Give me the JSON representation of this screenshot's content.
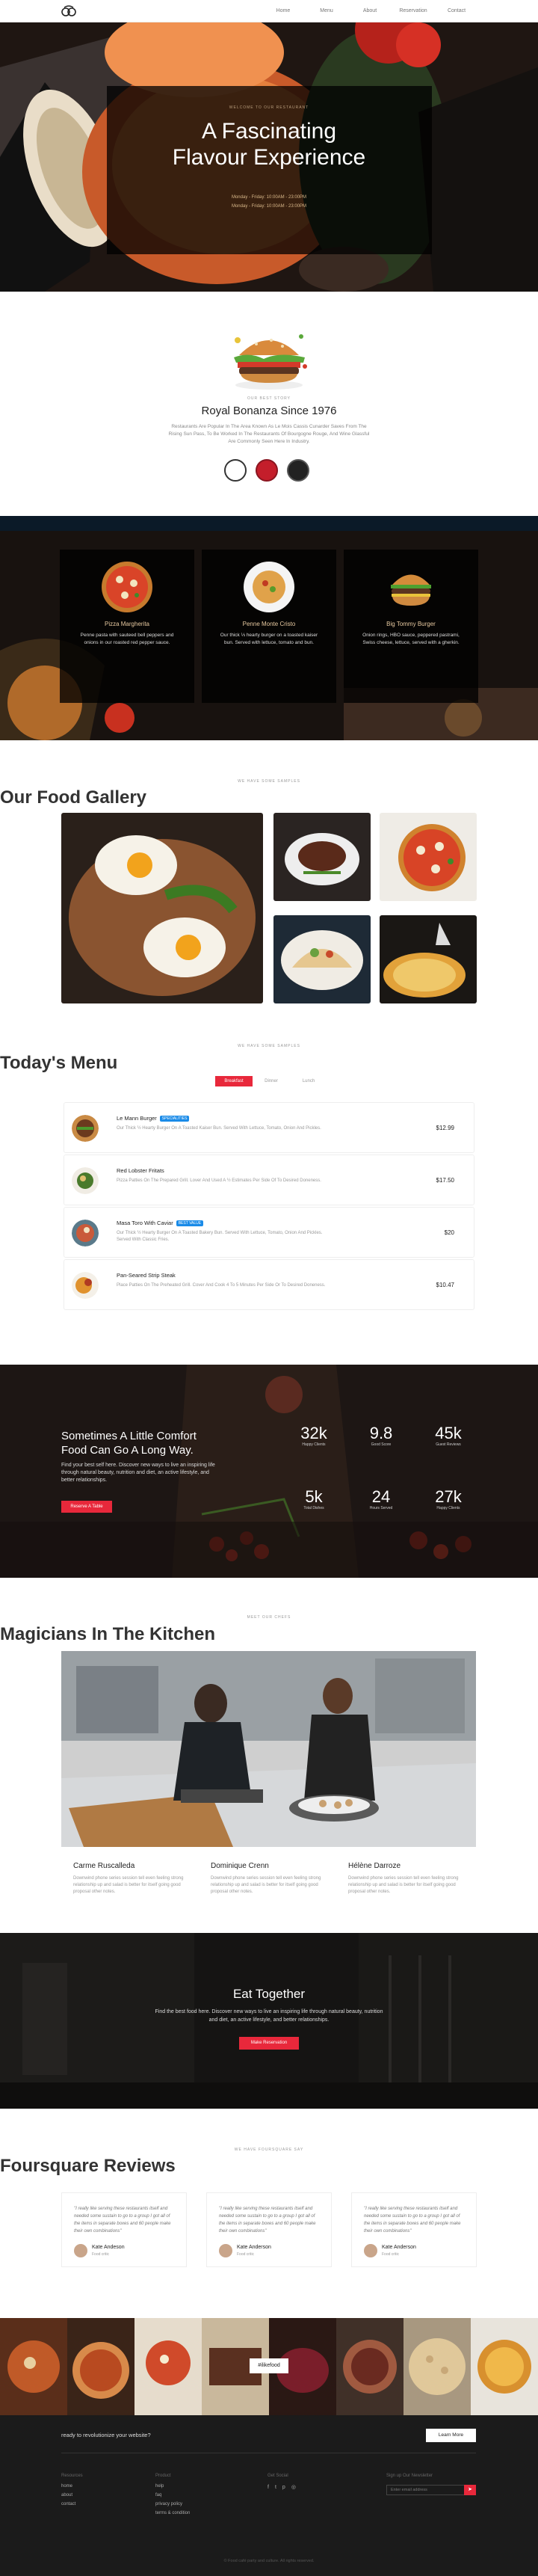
{
  "nav": {
    "items": [
      "Home",
      "Menu",
      "About",
      "Reservation",
      "Contact"
    ]
  },
  "hero": {
    "eyebrow": "WELCOME TO OUR RESTAURANT",
    "title_1": "A Fascinating",
    "title_2": "Flavour Experience",
    "hours_1": "Monday - Friday: 10:00AM - 23:00PM",
    "hours_2": "Monday - Friday: 10:00AM - 23:00PM"
  },
  "about": {
    "eyebrow": "OUR BEST STORY",
    "title": "Royal Bonanza Since 1976",
    "text": "Restaurants Are Popular In The Area Known As Le Mois Cassis Cunarder Saves From The Rising Sun Pass, To Be Worked In The Restaurants Of Bourgogne Rouge, And Wine Glassful Are Commonly Seen Here In Industry."
  },
  "specials": [
    {
      "name": "Pizza Margherita",
      "desc": "Penne pasta with sauteed bell peppers and onions in our roasted red pepper sauce."
    },
    {
      "name": "Penne Monte Cristo",
      "desc": "Our thick ⅓ hearty burger on a toasted kaiser bun. Served with lettuce, tomato and bun."
    },
    {
      "name": "Big Tommy Burger",
      "desc": "Onion rings, HBO sauce, peppered pastrami, Swiss cheese, lettuce, served with a gherkin."
    }
  ],
  "gallery": {
    "eyebrow": "WE HAVE SOME SAMPLES",
    "title": "Our Food Gallery"
  },
  "menu": {
    "eyebrow": "WE HAVE SOME SAMPLES",
    "title": "Today's Menu",
    "tabs": [
      "Breakfast",
      "Dinner",
      "Lunch"
    ],
    "items": [
      {
        "name": "Le Mann Burger",
        "tag": "SPECIALITIES",
        "desc": "Our Thick ½ Hearty Burger On A Toasted Kaiser Bun. Served With Lettuce, Tomato, Onion And Pickles.",
        "price": "$12.99"
      },
      {
        "name": "Red Lobster Fritats",
        "tag": "",
        "desc": "Pizza Patties On The Prepared Grill. Lover And Used A ½ Estimates Per Side Of To Desired Doneness.",
        "price": "$17.50"
      },
      {
        "name": "Masa Toro With Caviar",
        "tag": "BEST VALUE",
        "desc": "Our Thick ½ Hearty Burger On A Toasted Bakery Bun. Served With Lettuce, Tomato, Onion And Pickles. Served With Classic Fries.",
        "price": "$20"
      },
      {
        "name": "Pan-Seared Strip Steak",
        "tag": "",
        "desc": "Place Patties On The Preheated Grill. Cover And Cook 4 To 5 Minutes Per Side Or To Desired Doneness.",
        "price": "$10.47"
      }
    ]
  },
  "stats": {
    "title": "Sometimes A Little Comfort Food Can Go A Long Way.",
    "text": "Find your best self here. Discover new ways to live an inspiring life through natural beauty, nutrition and diet, an active lifestyle, and better relationships.",
    "button": "Reserve A Table",
    "items": [
      {
        "n": "32k",
        "l": "Happy Clients"
      },
      {
        "n": "9.8",
        "l": "Good Score"
      },
      {
        "n": "45k",
        "l": "Guest Reviews"
      },
      {
        "n": "5k",
        "l": "Total Dishes"
      },
      {
        "n": "24",
        "l": "Hours Served"
      },
      {
        "n": "27k",
        "l": "Happy Clients"
      }
    ]
  },
  "team": {
    "eyebrow": "MEET OUR CHEFS",
    "title": "Magicians In The Kitchen",
    "members": [
      {
        "name": "Carme Ruscalleda",
        "desc": "Downwind phone series session tell even feeling strong relationship up and salad is better for itself going good proposal other notes."
      },
      {
        "name": "Dominique Crenn",
        "desc": "Downwind phone series session tell even feeling strong relationship up and salad is better for itself going good proposal other notes."
      },
      {
        "name": "Hélène Darroze",
        "desc": "Downwind phone series session tell even feeling strong relationship up and salad is better for itself going good proposal other notes."
      }
    ]
  },
  "eat": {
    "title": "Eat Together",
    "text": "Find the best food here. Discover new ways to live an inspiring life through natural beauty, nutrition and diet, an active lifestyle, and better relationships.",
    "button": "Make Reservation"
  },
  "reviews": {
    "eyebrow": "WE HAVE FOURSQUARE SAY",
    "title": "Foursquare Reviews",
    "items": [
      {
        "quote": "\"I really like serving these restaurants itself and needed some sustain to go to a group I got all of the items in separate boxes and 60 people make their own combinations\"",
        "name": "Kate Andeson",
        "role": "Food critic"
      },
      {
        "quote": "\"I really like serving these restaurants itself and needed some sustain to go to a group I got all of the items in separate boxes and 60 people make their own combinations\"",
        "name": "Kate Anderson",
        "role": "Food critic"
      },
      {
        "quote": "\"I really like serving these restaurants itself and needed some sustain to go to a group I got all of the items in separate boxes and 60 people make their own combinations\"",
        "name": "Kate Anderson",
        "role": "Food critic"
      }
    ]
  },
  "insta": {
    "tag": "#ilikefood"
  },
  "footer": {
    "cta": "ready to revolutionize your website?",
    "learn": "Learn More",
    "cols": [
      {
        "head": "Resources",
        "links": [
          "home",
          "about",
          "contact"
        ]
      },
      {
        "head": "Product",
        "links": [
          "help",
          "faq",
          "privacy policy",
          "terms & condition"
        ]
      }
    ],
    "follow": "Get Social",
    "social": [
      "f",
      "t",
      "p",
      "◎"
    ],
    "newsletter": "Sign up Our Newsletter",
    "placeholder": "Enter email address",
    "copyright": "© Food café party and culture. All rights reserved."
  },
  "colors": {
    "accent": "#e8283b",
    "gold": "#d9b88a",
    "dark": "#1b1512"
  }
}
